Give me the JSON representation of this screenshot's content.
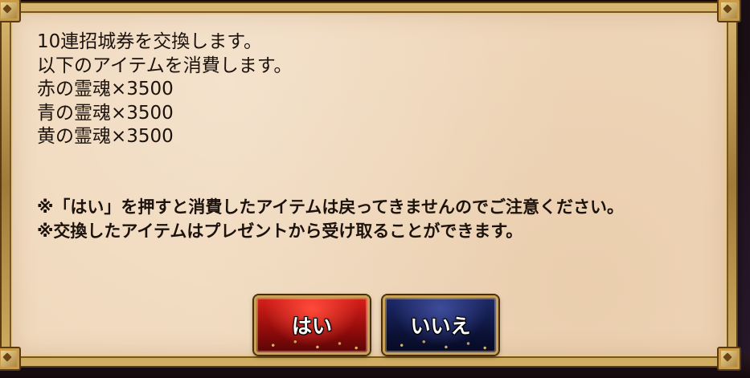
{
  "dialog": {
    "lines": [
      "10連招城券を交換します。",
      "以下のアイテムを消費します。",
      "赤の霊魂×3500",
      "青の霊魂×3500",
      "黄の霊魂×3500"
    ],
    "notes": [
      "※「はい」を押すと消費したアイテムは戻ってきませんのでご注意ください。",
      "※交換したアイテムはプレゼントから受け取ることができます。"
    ]
  },
  "buttons": {
    "yes_label": "はい",
    "no_label": "いいえ"
  },
  "colors": {
    "panel": "#f0d8bb",
    "frame": "#c9a258",
    "yes_button": "#c01a14",
    "no_button": "#141c4e"
  }
}
